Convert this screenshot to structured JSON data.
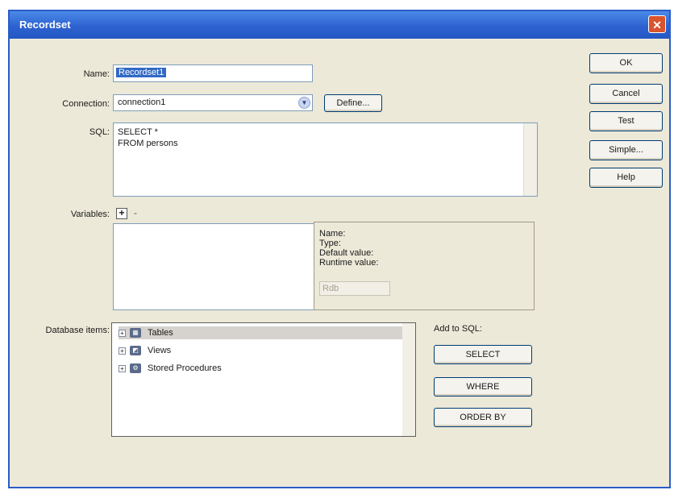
{
  "window": {
    "title": "Recordset",
    "close_glyph": "✕"
  },
  "form": {
    "name_label": "Name:",
    "name_value": "Recordset1",
    "connection_label": "Connection:",
    "connection_value": "connection1",
    "define_label": "Define...",
    "sql_label": "SQL:",
    "sql_value": "SELECT *\nFROM persons",
    "variables_label": "Variables:",
    "variables_add": "+",
    "variables_remove": "-"
  },
  "variable_details": {
    "name_label": "Name:",
    "type_label": "Type:",
    "default_label": "Default value:",
    "runtime_label": "Runtime value:",
    "runtime_value": "Rdb"
  },
  "database": {
    "label": "Database items:",
    "items": [
      {
        "label": "Tables",
        "icon": "table-icon"
      },
      {
        "label": "Views",
        "icon": "view-icon"
      },
      {
        "label": "Stored Procedures",
        "icon": "procedure-icon"
      }
    ]
  },
  "add_to_sql": {
    "label": "Add to SQL:",
    "select_label": "SELECT",
    "where_label": "WHERE",
    "orderby_label": "ORDER BY"
  },
  "side_buttons": {
    "ok": "OK",
    "cancel": "Cancel",
    "test": "Test",
    "simple": "Simple...",
    "help": "Help"
  },
  "colors": {
    "titlebar": "#2d62d0",
    "dialog_bg": "#ece9d8",
    "selection": "#316ac5",
    "close": "#d9532c"
  }
}
